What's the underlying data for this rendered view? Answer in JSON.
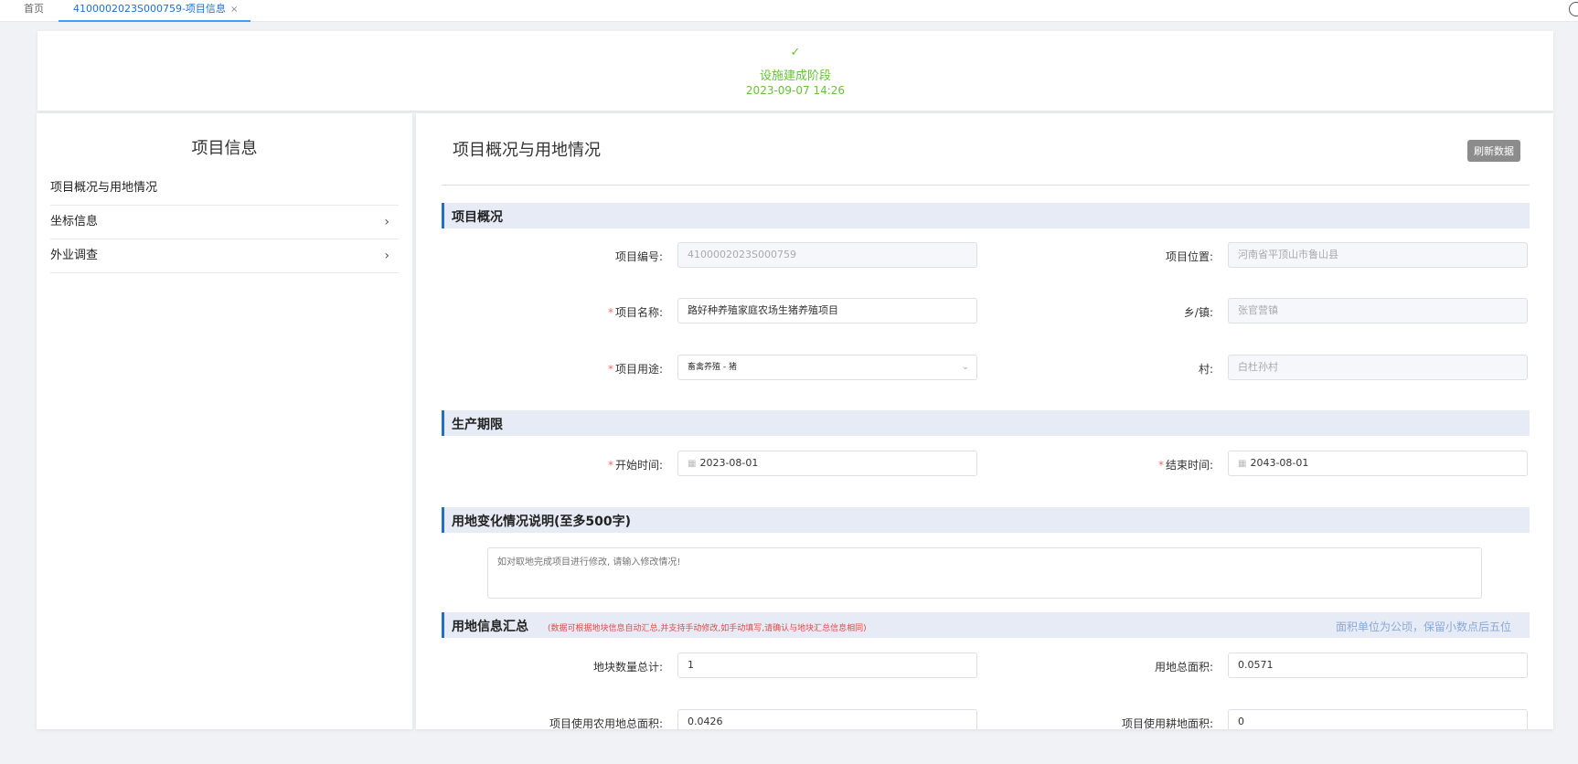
{
  "tabs": {
    "home": "首页",
    "active": "4100002023S000759-项目信息",
    "close": "×"
  },
  "stage": {
    "check": "✓",
    "title": "设施建成阶段",
    "date": "2023-09-07 14:26"
  },
  "left": {
    "title": "项目信息",
    "items": [
      {
        "label": "项目概况与用地情况"
      },
      {
        "label": "坐标信息",
        "chevron": "›"
      },
      {
        "label": "外业调查",
        "chevron": "›"
      }
    ]
  },
  "main": {
    "title": "项目概况与用地情况",
    "refresh_label": "刷新数据"
  },
  "sections": {
    "overview": "项目概况",
    "period": "生产期限",
    "change": "用地变化情况说明(至多500字)",
    "summary": "用地信息汇总",
    "summary_note": "(数据可根据地块信息自动汇总,并支持手动修改,如手动填写,请确认与地块汇总信息相同)",
    "summary_right": "面积单位为公顷，保留小数点后五位"
  },
  "fields": {
    "project_no_label": "项目编号:",
    "project_no": "4100002023S000759",
    "location_label": "项目位置:",
    "location": "河南省平顶山市鲁山县",
    "name_label": "项目名称:",
    "name": "路好种养殖家庭农场生猪养殖项目",
    "town_label": "乡/镇:",
    "town": "张官营镇",
    "purpose_label": "项目用途:",
    "purpose": "畜禽养殖 - 猪",
    "village_label": "村:",
    "village": "白杜孙村",
    "start_label": "开始时间:",
    "start": "2023-08-01",
    "end_label": "结束时间:",
    "end": "2043-08-01",
    "change_placeholder": "如对取地完成项目进行修改, 请输入修改情况!",
    "plot_count_label": "地块数量总计:",
    "plot_count": "1",
    "total_area_label": "用地总面积:",
    "total_area": "0.0571",
    "agri_area_label": "项目使用农用地总面积:",
    "agri_area": "0.0426",
    "farm_area_label": "项目使用耕地面积:",
    "farm_area": "0"
  },
  "required_mark": "*",
  "colors": {
    "accent": "#1f6fd1",
    "success": "#67c23a",
    "required": "#f56c6c"
  }
}
